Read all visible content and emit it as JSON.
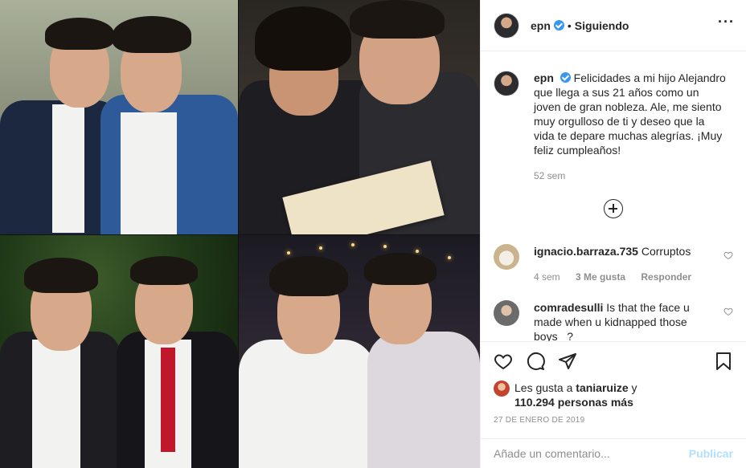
{
  "post": {
    "username": "epn",
    "follow_status": "Siguiendo",
    "separator": "•",
    "more_icon": "more-options-icon"
  },
  "caption": {
    "username": "epn",
    "text": "Felicidades a mi hijo Alejandro que llega a sus 21 años como un joven de gran nobleza. Ale, me siento muy orgulloso de ti y deseo que la vida te depare muchas alegrías. ¡Muy feliz cumpleaños!",
    "time": "52 sem"
  },
  "comments": [
    {
      "username": "ignacio.barraza.735",
      "text": "Corruptos",
      "time": "4 sem",
      "likes": "3 Me gusta",
      "reply": "Responder"
    },
    {
      "username": "comradesulli",
      "text": "Is that the face u made when u kidnapped those boys _?"
    }
  ],
  "likes": {
    "prefix": "Les gusta a",
    "user": "taniaruize",
    "connector": "y",
    "count": "110.294 personas más"
  },
  "date": "27 DE ENERO DE 2019",
  "add_comment": {
    "placeholder": "Añade un comentario...",
    "publish_label": "Publicar"
  },
  "colors": {
    "verified": "#3897f0",
    "publish_disabled": "#b2dffc",
    "muted": "#8e8e8e"
  }
}
